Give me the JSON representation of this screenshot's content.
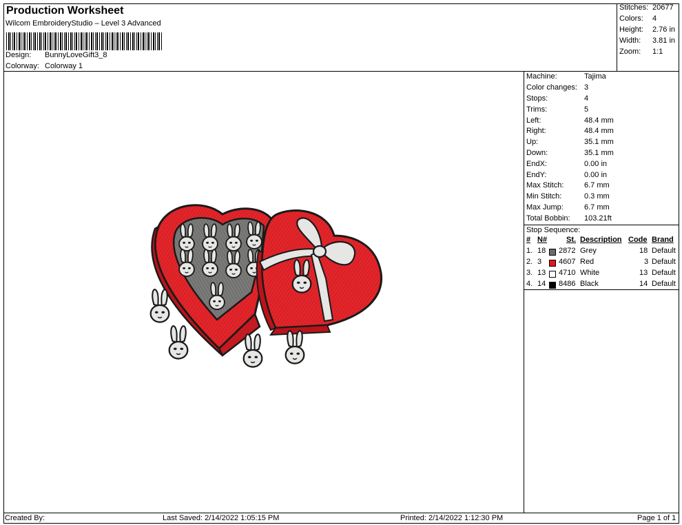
{
  "header": {
    "title": "Production Worksheet",
    "subtitle": "Wilcom EmbroideryStudio – Level 3 Advanced",
    "design_label": "Design:",
    "design_value": "BunnyLoveGift3_8",
    "colorway_label": "Colorway:",
    "colorway_value": "Colorway 1"
  },
  "summary": {
    "stitches_label": "Stitches:",
    "stitches_value": "20677",
    "colors_label": "Colors:",
    "colors_value": "4",
    "height_label": "Height:",
    "height_value": "2.76 in",
    "width_label": "Width:",
    "width_value": "3.81 in",
    "zoom_label": "Zoom:",
    "zoom_value": "1:1"
  },
  "machine_info": [
    {
      "label": "Machine:",
      "value": "Tajima"
    },
    {
      "label": "Color changes:",
      "value": "3"
    },
    {
      "label": "Stops:",
      "value": "4"
    },
    {
      "label": "Trims:",
      "value": "5"
    },
    {
      "label": "Left:",
      "value": "48.4 mm"
    },
    {
      "label": "Right:",
      "value": "48.4 mm"
    },
    {
      "label": "Up:",
      "value": "35.1 mm"
    },
    {
      "label": "Down:",
      "value": "35.1 mm"
    },
    {
      "label": "EndX:",
      "value": "0.00 in"
    },
    {
      "label": "EndY:",
      "value": "0.00 in"
    },
    {
      "label": "Max Stitch:",
      "value": "6.7 mm"
    },
    {
      "label": "Min Stitch:",
      "value": "0.3 mm"
    },
    {
      "label": "Max Jump:",
      "value": "6.7 mm"
    },
    {
      "label": "Total Bobbin:",
      "value": "103.21ft"
    }
  ],
  "stop_sequence": {
    "title": "Stop Sequence:",
    "headers": {
      "num": "#",
      "n": "N#",
      "st": "St.",
      "description": "Description",
      "code": "Code",
      "brand": "Brand"
    },
    "rows": [
      {
        "num": "1.",
        "n": "18",
        "st": "2872",
        "description": "Grey",
        "code": "18",
        "brand": "Default",
        "color": "#6b6b6b"
      },
      {
        "num": "2.",
        "n": "3",
        "st": "4607",
        "description": "Red",
        "code": "3",
        "brand": "Default",
        "color": "#e8141c"
      },
      {
        "num": "3.",
        "n": "13",
        "st": "4710",
        "description": "White",
        "code": "13",
        "brand": "Default",
        "color": "#ffffff"
      },
      {
        "num": "4.",
        "n": "14",
        "st": "8486",
        "description": "Black",
        "code": "14",
        "brand": "Default",
        "color": "#000000"
      }
    ]
  },
  "footer": {
    "created_by": "Created By:",
    "last_saved": "Last Saved: 2/14/2022 1:05:15 PM",
    "printed": "Printed: 2/14/2022 1:12:30 PM",
    "page": "Page 1 of 1"
  }
}
